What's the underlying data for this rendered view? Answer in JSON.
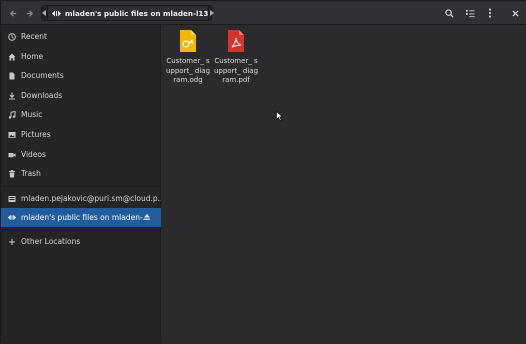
{
  "header": {
    "path_label": "mladen's public files on mladen-l13",
    "icons": {
      "back": "back-arrow-icon",
      "forward": "forward-arrow-icon",
      "path_left": "path-scroll-left-icon",
      "path_right": "path-scroll-right-icon",
      "network": "network-share-icon",
      "search": "search-icon",
      "view": "view-options-icon",
      "menu": "menu-icon",
      "close": "close-icon"
    }
  },
  "sidebar": {
    "items": [
      {
        "label": "Recent",
        "icon": "clock-icon"
      },
      {
        "label": "Home",
        "icon": "home-icon"
      },
      {
        "label": "Documents",
        "icon": "document-icon"
      },
      {
        "label": "Downloads",
        "icon": "download-icon"
      },
      {
        "label": "Music",
        "icon": "music-icon"
      },
      {
        "label": "Pictures",
        "icon": "picture-icon"
      },
      {
        "label": "Videos",
        "icon": "video-icon"
      },
      {
        "label": "Trash",
        "icon": "trash-icon"
      },
      {
        "label": "mladen.pejakovic@puri.sm@cloud.p...",
        "icon": "cloud-account-icon"
      },
      {
        "label": "mladen's public files on mladen-...",
        "icon": "network-share-icon",
        "active": true
      },
      {
        "label": "Other Locations",
        "icon": "plus-icon"
      }
    ]
  },
  "files": [
    {
      "name": "Customer_ support_ diagram.odg",
      "icon": "odg-drawing-file-icon",
      "color": "#f0b400"
    },
    {
      "name": "Customer_ support_ diagram.pdf",
      "icon": "pdf-file-icon",
      "color": "#d9312b"
    }
  ],
  "colors": {
    "selection": "#215d9c",
    "background": "#2b2b2d",
    "sidebar": "#252527"
  }
}
